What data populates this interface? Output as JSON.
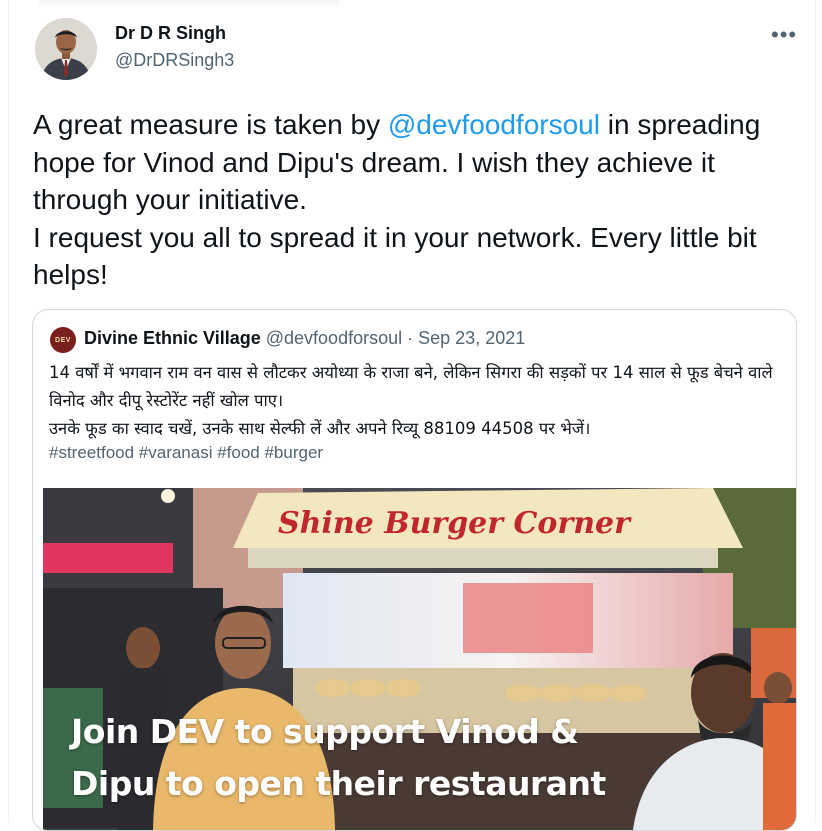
{
  "tweet": {
    "author_name": "Dr D R Singh",
    "author_handle": "@DrDRSingh3",
    "more_icon": "more-horizontal-icon",
    "text_before_mention": "A great measure is taken by ",
    "mention": "@devfoodforsoul",
    "text_after_mention": " in spreading hope for Vinod and Dipu's dream. I wish they achieve it through your initiative.",
    "text_line2": "I request you all to spread it in your network. Every little bit helps!"
  },
  "quote": {
    "avatar_text": "DEV",
    "author_name": "Divine Ethnic Village",
    "author_handle": "@devfoodforsoul",
    "separator": "·",
    "date": "Sep 23, 2021",
    "text_line1": "14 वर्षों में भगवान राम वन वास से लौटकर अयोध्या के राजा बने, लेकिन सिगरा की सड़कों पर 14 साल से फूड बेचने वाले विनोद और दीपू रेस्टोरेंट नहीं खोल पाए।",
    "text_line2": "उनके फूड का स्वाद चखें, उनके साथ सेल्फी लें और अपने रिव्यू 88109 44508 पर भेजें।",
    "hashtags": "#streetfood #varanasi #food #burger",
    "media": {
      "sign_text": "Shine Burger Corner",
      "caption_line1": "Join DEV to support Vinod &",
      "caption_line2": "Dipu to open their restaurant"
    }
  },
  "colors": {
    "link": "#1d9bf0",
    "secondary_text": "#536471",
    "border": "#cfd9de",
    "sign_red": "#c0262b"
  }
}
